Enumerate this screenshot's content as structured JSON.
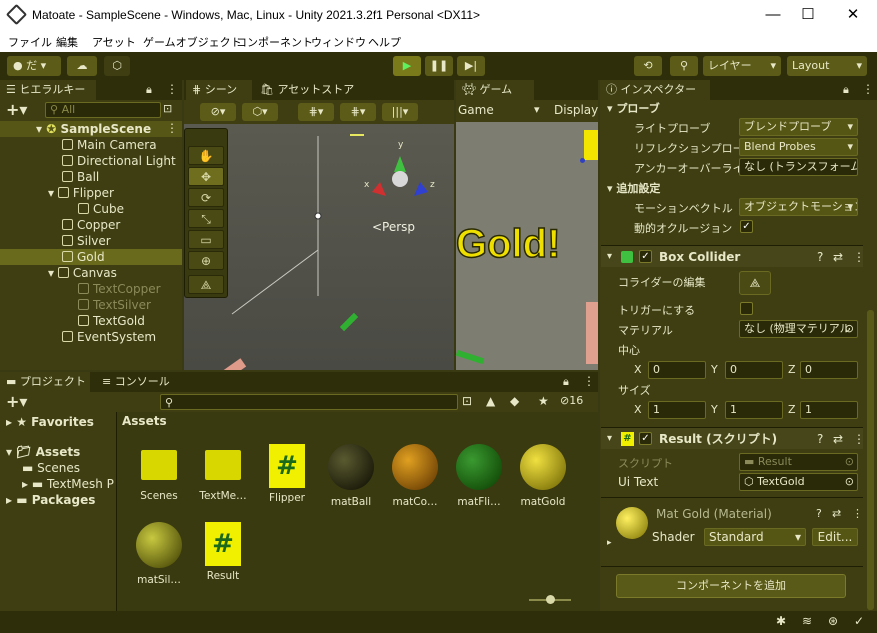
{
  "window": {
    "title": "Matoate - SampleScene - Windows, Mac, Linux - Unity 2021.3.2f1 Personal <DX11>",
    "minimize": "—",
    "maximize": "☐",
    "close": "✕"
  },
  "menu": [
    "ファイル",
    "編集",
    "アセット",
    "ゲームオブジェクト",
    "コンポーネント",
    "ウィンドウ",
    "ヘルプ"
  ],
  "toolbar": {
    "account": "だ",
    "layers": "レイヤー",
    "layout": "Layout"
  },
  "hierarchy": {
    "tab": "ヒエラルキー",
    "search_placeholder": "All",
    "scene": "SampleScene",
    "items": [
      "Main Camera",
      "Directional Light",
      "Ball",
      "Flipper",
      "Cube",
      "Copper",
      "Silver",
      "Gold",
      "Canvas",
      "TextCopper",
      "TextSilver",
      "TextGold",
      "EventSystem"
    ]
  },
  "scene": {
    "tab_scene": "シーン",
    "tab_store": "アセットストア",
    "persp": "<Persp",
    "axis_y": "y",
    "axis_x": "x",
    "axis_z": "z"
  },
  "game": {
    "tab": "ゲーム",
    "display_select": "Game",
    "display": "Display",
    "gold_text": "Gold!"
  },
  "project": {
    "tab_project": "プロジェクト",
    "tab_console": "コンソール",
    "hidden_count": "16",
    "tree": {
      "favorites": "Favorites",
      "assets": "Assets",
      "scenes": "Scenes",
      "textmesh": "TextMesh P",
      "packages": "Packages"
    },
    "assets_header": "Assets",
    "assets": [
      {
        "name": "Scenes",
        "kind": "folder"
      },
      {
        "name": "TextMe…",
        "kind": "folder"
      },
      {
        "name": "Flipper",
        "kind": "script"
      },
      {
        "name": "matBall",
        "kind": "mat",
        "color": "#1a1a00"
      },
      {
        "name": "matCo…",
        "kind": "mat",
        "color": "#8a5a00"
      },
      {
        "name": "matFli…",
        "kind": "mat",
        "color": "#145a10"
      },
      {
        "name": "matGold",
        "kind": "mat",
        "color": "#b8a800"
      },
      {
        "name": "matSil…",
        "kind": "mat",
        "color": "#8a8a10"
      },
      {
        "name": "Result",
        "kind": "script"
      }
    ]
  },
  "inspector": {
    "tab": "インスペクター",
    "probes": {
      "header": "プローブ",
      "light_probe_label": "ライトプローブ",
      "light_probe": "ブレンドプローブ",
      "reflection_label": "リフレクションプローブ",
      "reflection": "Blend Probes",
      "anchor_label": "アンカーオーバーライド",
      "anchor": "なし (トランスフォーム"
    },
    "additional": {
      "header": "追加設定",
      "motion_label": "モーションベクトル",
      "motion": "オブジェクトモーション:",
      "occlusion_label": "動的オクルージョン"
    },
    "box_collider": {
      "title": "Box Collider",
      "edit_label": "コライダーの編集",
      "trigger_label": "トリガーにする",
      "material_label": "マテリアル",
      "material": "なし (物理マテリアル",
      "center_label": "中心",
      "size_label": "サイズ",
      "center": {
        "x": "0",
        "y": "0",
        "z": "0"
      },
      "size": {
        "x": "1",
        "y": "1",
        "z": "1"
      }
    },
    "result": {
      "title": "Result (スクリプト)",
      "script_label": "スクリプト",
      "script": "Result",
      "uitext_label": "Ui Text",
      "uitext": "TextGold"
    },
    "material": {
      "title": "Mat Gold (Material)",
      "shader_label": "Shader",
      "shader": "Standard",
      "edit": "Edit..."
    },
    "add_component": "コンポーネントを追加"
  }
}
